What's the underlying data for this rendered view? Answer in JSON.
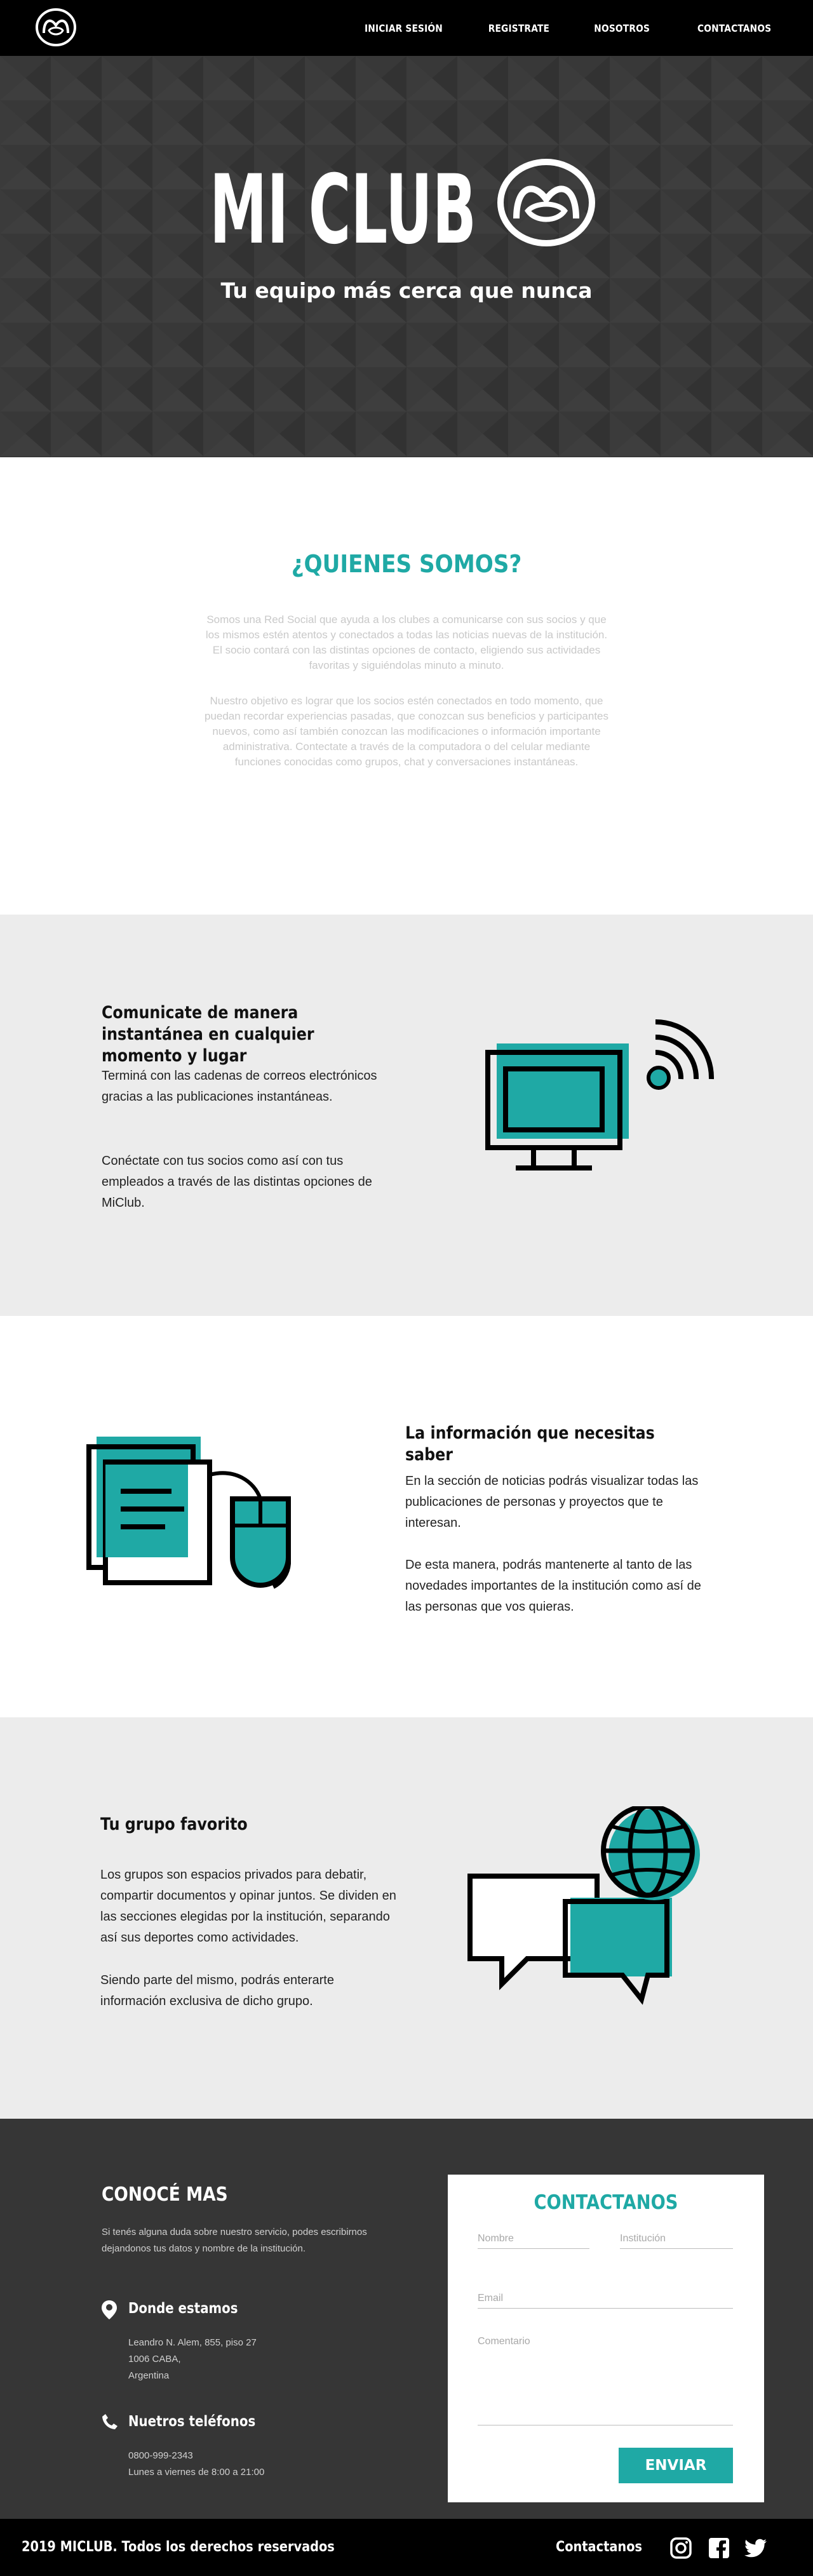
{
  "nav": {
    "items": [
      "INICIAR SESIÓN",
      "REGISTRATE",
      "NOSOTROS",
      "CONTACTANOS"
    ]
  },
  "hero": {
    "brand": "MI CLUB",
    "tagline": "Tu equipo más cerca que nunca"
  },
  "about": {
    "title": "¿QUIENES SOMOS?",
    "p1": "Somos una Red Social que ayuda a los clubes a comunicarse con sus socios y que los mismos estén atentos y conectados a todas las noticias nuevas de la institución. El socio contará con las distintas opciones de contacto, eligiendo sus actividades favoritas y siguiéndolas minuto a minuto.",
    "p2": "Nuestro objetivo es lograr que los socios estén conectados en todo momento, que puedan recordar experiencias pasadas, que conozcan sus beneficios y participantes nuevos, como así también conozcan las modificaciones o información importante administrativa. Contectate a través de la computadora o del celular mediante funciones conocidas como grupos, chat y conversaciones instantáneas."
  },
  "features": [
    {
      "title": "Comunicate de manera instantánea en cualquier momento y lugar",
      "p1": "Terminá con las cadenas de correos electrónicos gracias a las publicaciones instantáneas.",
      "p2": "Conéctate con tus socios como así con tus empleados a través de las distintas opciones de MiClub."
    },
    {
      "title": "La información que necesitas saber",
      "p1": "En la sección de noticias podrás visualizar todas las publicaciones de personas y proyectos que te interesan.",
      "p2": "De esta manera, podrás mantenerte al tanto de las novedades importantes de la institución como así de las personas que vos quieras."
    },
    {
      "title": "Tu grupo favorito",
      "p1": "Los grupos son espacios privados para debatir, compartir documentos y opinar juntos. Se dividen en las secciones elegidas por la institución, separando así sus deportes como actividades.",
      "p2": "Siendo parte del mismo, podrás enterarte información exclusiva de dicho grupo."
    }
  ],
  "contact": {
    "title": "CONOCÉ MAS",
    "intro": "Si tenés alguna duda sobre nuestro servicio, podes escribirnos dejandonos tus datos y nombre de la institución.",
    "location_title": "Donde estamos",
    "address": [
      "Leandro N. Alem, 855, piso 27",
      "1006 CABA,",
      "Argentina"
    ],
    "phone_title": "Nuetros teléfonos",
    "phones": [
      "0800-999-2343",
      "Lunes a viernes de 8:00 a 21:00"
    ]
  },
  "form": {
    "title": "CONTACTANOS",
    "name_placeholder": "Nombre",
    "institution_placeholder": "Institución",
    "email_placeholder": "Email",
    "comment_placeholder": "Comentario",
    "submit": "ENVIAR"
  },
  "footer": {
    "copyright": "2019 MICLUB. Todos los derechos reservados",
    "contact_link": "Contactanos",
    "social_icons": [
      "instagram-icon",
      "facebook-icon",
      "twitter-icon"
    ]
  },
  "colors": {
    "accent": "#1fa9a5",
    "dark": "#363636",
    "black": "#000000",
    "light_gray": "#ececec"
  }
}
